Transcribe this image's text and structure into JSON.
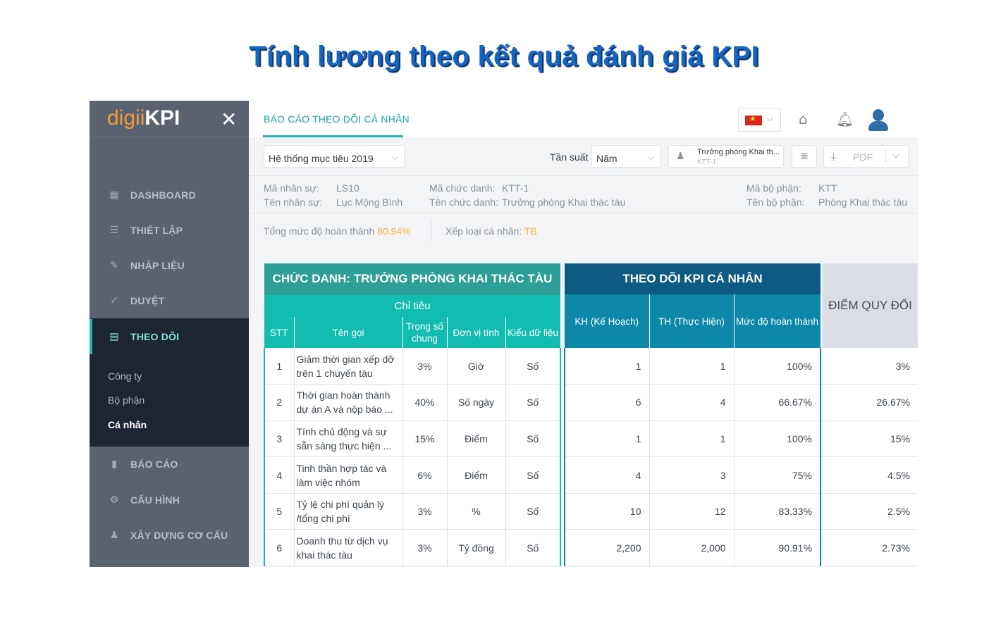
{
  "banner_title": "Tính lương theo kết quả đánh giá KPI",
  "sidebar": {
    "logo_part1": "digii",
    "logo_part2": "KPI",
    "items": [
      {
        "label": "DASHBOARD",
        "icon": "dashboard-icon"
      },
      {
        "label": "THIẾT LẬP",
        "icon": "sliders-icon"
      },
      {
        "label": "NHẬP LIỆU",
        "icon": "edit-icon"
      },
      {
        "label": "DUYỆT",
        "icon": "check-circle-icon"
      },
      {
        "label": "THEO DÕI",
        "icon": "clipboard-icon"
      },
      {
        "label": "BÁO CÁO",
        "icon": "bar-chart-icon"
      },
      {
        "label": "CẤU HÌNH",
        "icon": "gear-icon"
      },
      {
        "label": "XÂY DỰNG CƠ CẤU",
        "icon": "org-structure-icon"
      }
    ],
    "sub_items": [
      "Công ty",
      "Bộ phận",
      "Cá nhân"
    ]
  },
  "header": {
    "tab_label": "BÁO CÁO THEO DÕI CÁ NHÂN"
  },
  "filters": {
    "goal_system": "Hệ thống mục tiêu 2019",
    "frequency_label": "Tần suất",
    "frequency_value": "Năm",
    "org_title": "Trưởng phòng Khai th...",
    "org_code": "KTT-1",
    "pdf_label": "PDF"
  },
  "employee": {
    "code_label": "Mã nhân sự:",
    "code": "LS10",
    "name_label": "Tên nhân sự:",
    "name": "Lục Mộng Bình",
    "title_code_label": "Mã chức danh:",
    "title_code": "KTT-1",
    "title_name_label": "Tên chức danh:",
    "title_name": "Trưởng phòng Khai thác tàu",
    "dept_code_label": "Mã bộ phận:",
    "dept_code": "KTT",
    "dept_name_label": "Tên bộ phận:",
    "dept_name": "Phòng Khai thác tàu"
  },
  "summary": {
    "completion_label": "Tổng mức độ hoàn thành",
    "completion_value": "80.94%",
    "rank_label": "Xếp loại cá nhân:",
    "rank_value": "TB"
  },
  "table_left": {
    "title": "CHỨC DANH: TRƯỞNG PHÒNG KHAI THÁC TÀU",
    "subtitle": "Chỉ tiêu",
    "columns": [
      "STT",
      "Tên gọi",
      "Trọng số chung",
      "Đơn vị tính",
      "Kiểu dữ liệu"
    ]
  },
  "table_mid": {
    "title": "THEO DÕI KPI CÁ NHÂN",
    "columns": [
      "KH (Kế Hoạch)",
      "TH (Thực Hiện)",
      "Mức độ hoàn thành"
    ]
  },
  "table_right": {
    "title": "ĐIỂM QUY ĐỔI"
  },
  "rows": [
    {
      "stt": "1",
      "name1": "Giảm thời gian xếp dỡ",
      "name2": "trên 1 chuyến tàu",
      "weight": "3%",
      "unit": "Giờ",
      "dtype": "Số",
      "kh": "1",
      "th": "1",
      "pct": "100%",
      "score": "3%"
    },
    {
      "stt": "2",
      "name1": "Thời gian hoàn thành",
      "name2": "dự án A và nộp báo ...",
      "weight": "40%",
      "unit": "Số ngày",
      "dtype": "Số",
      "kh": "6",
      "th": "4",
      "pct": "66.67%",
      "score": "26.67%"
    },
    {
      "stt": "3",
      "name1": "Tính chủ động và sự",
      "name2": "sẵn sàng thực hiện ...",
      "weight": "15%",
      "unit": "Điểm",
      "dtype": "Số",
      "kh": "1",
      "th": "1",
      "pct": "100%",
      "score": "15%"
    },
    {
      "stt": "4",
      "name1": "Tinh thần hợp tác và",
      "name2": "làm việc nhóm",
      "weight": "6%",
      "unit": "Điểm",
      "dtype": "Số",
      "kh": "4",
      "th": "3",
      "pct": "75%",
      "score": "4.5%"
    },
    {
      "stt": "5",
      "name1": "Tỷ lệ chi phí quản lý",
      "name2": "/tổng chi phí",
      "weight": "3%",
      "unit": "%",
      "dtype": "Số",
      "kh": "10",
      "th": "12",
      "pct": "83.33%",
      "score": "2.5%"
    },
    {
      "stt": "6",
      "name1": "Doanh thu từ dịch vụ",
      "name2": "khai thác tàu",
      "weight": "3%",
      "unit": "Tỷ đồng",
      "dtype": "Số",
      "kh": "2,200",
      "th": "2,000",
      "pct": "90.91%",
      "score": "2.73%"
    }
  ]
}
